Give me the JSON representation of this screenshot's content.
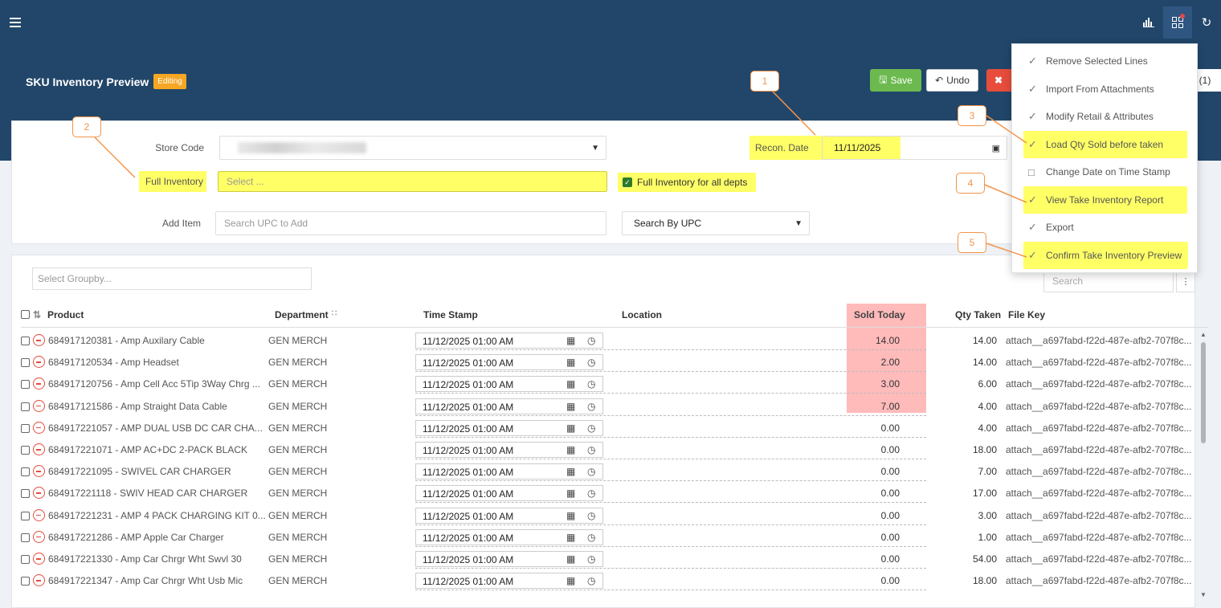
{
  "header": {
    "title": "SKU Inventory Preview",
    "status_badge": "Editing",
    "save_label": "Save",
    "undo_label": "Undo",
    "more_label": "(1)"
  },
  "top_icons": [
    "hamburger-menu-icon",
    "bar-chart-icon",
    "grid-apps-icon",
    "refresh-icon"
  ],
  "form": {
    "store_code_label": "Store Code",
    "recon_date_label": "Recon. Date",
    "recon_date_value": "11/11/2025",
    "full_inventory_label": "Full Inventory",
    "full_inventory_placeholder": "Select ...",
    "full_inventory_all_depts_label": "Full Inventory for all depts",
    "full_inventory_all_depts_checked": true,
    "add_item_label": "Add Item",
    "add_item_placeholder": "Search UPC to Add",
    "search_by_value": "Search By UPC"
  },
  "dropdown_menu": [
    {
      "label": "Remove Selected Lines",
      "icon": "check-icon",
      "highlighted": false
    },
    {
      "label": "Import From Attachments",
      "icon": "check-icon",
      "highlighted": false
    },
    {
      "label": "Modify Retail & Attributes",
      "icon": "check-icon",
      "highlighted": false
    },
    {
      "label": "Load Qty Sold before taken",
      "icon": "check-icon",
      "highlighted": true
    },
    {
      "label": "Change Date on Time Stamp",
      "icon": "calendar-icon",
      "highlighted": false
    },
    {
      "label": "View Take Inventory Report",
      "icon": "check-icon",
      "highlighted": true
    },
    {
      "label": "Export",
      "icon": "check-icon",
      "highlighted": false
    },
    {
      "label": "Confirm Take Inventory Preview",
      "icon": "check-icon",
      "highlighted": true
    }
  ],
  "callouts": [
    "1",
    "2",
    "3",
    "4",
    "5"
  ],
  "grid": {
    "groupby_placeholder": "Select Groupby...",
    "search_placeholder": "Search",
    "columns": {
      "product": "Product",
      "department": "Department",
      "time_stamp": "Time Stamp",
      "location": "Location",
      "sold_today": "Sold Today",
      "qty_taken": "Qty Taken",
      "file_key": "File Key"
    },
    "rows": [
      {
        "product": "684917120381 - Amp Auxilary Cable",
        "department": "GEN MERCH",
        "time_stamp": "11/12/2025 01:00 AM",
        "sold_today": "14.00",
        "qty_taken": "14.00",
        "file_key": "attach__a697fabd-f22d-487e-afb2-707f8c..."
      },
      {
        "product": "684917120534 - Amp Headset",
        "department": "GEN MERCH",
        "time_stamp": "11/12/2025 01:00 AM",
        "sold_today": "2.00",
        "qty_taken": "14.00",
        "file_key": "attach__a697fabd-f22d-487e-afb2-707f8c..."
      },
      {
        "product": "684917120756 - Amp Cell Acc 5Tip 3Way Chrg ...",
        "department": "GEN MERCH",
        "time_stamp": "11/12/2025 01:00 AM",
        "sold_today": "3.00",
        "qty_taken": "6.00",
        "file_key": "attach__a697fabd-f22d-487e-afb2-707f8c..."
      },
      {
        "product": "684917121586 - Amp Straight Data Cable",
        "department": "GEN MERCH",
        "time_stamp": "11/12/2025 01:00 AM",
        "sold_today": "7.00",
        "qty_taken": "4.00",
        "file_key": "attach__a697fabd-f22d-487e-afb2-707f8c..."
      },
      {
        "product": "684917221057 - AMP DUAL USB DC CAR CHA...",
        "department": "GEN MERCH",
        "time_stamp": "11/12/2025 01:00 AM",
        "sold_today": "0.00",
        "qty_taken": "4.00",
        "file_key": "attach__a697fabd-f22d-487e-afb2-707f8c..."
      },
      {
        "product": "684917221071 - AMP AC+DC 2-PACK BLACK",
        "department": "GEN MERCH",
        "time_stamp": "11/12/2025 01:00 AM",
        "sold_today": "0.00",
        "qty_taken": "18.00",
        "file_key": "attach__a697fabd-f22d-487e-afb2-707f8c..."
      },
      {
        "product": "684917221095 - SWIVEL CAR CHARGER",
        "department": "GEN MERCH",
        "time_stamp": "11/12/2025 01:00 AM",
        "sold_today": "0.00",
        "qty_taken": "7.00",
        "file_key": "attach__a697fabd-f22d-487e-afb2-707f8c..."
      },
      {
        "product": "684917221118 - SWIV HEAD CAR CHARGER",
        "department": "GEN MERCH",
        "time_stamp": "11/12/2025 01:00 AM",
        "sold_today": "0.00",
        "qty_taken": "17.00",
        "file_key": "attach__a697fabd-f22d-487e-afb2-707f8c..."
      },
      {
        "product": "684917221231 - AMP 4 PACK CHARGING KIT 0...",
        "department": "GEN MERCH",
        "time_stamp": "11/12/2025 01:00 AM",
        "sold_today": "0.00",
        "qty_taken": "3.00",
        "file_key": "attach__a697fabd-f22d-487e-afb2-707f8c..."
      },
      {
        "product": "684917221286 - AMP Apple Car Charger",
        "department": "GEN MERCH",
        "time_stamp": "11/12/2025 01:00 AM",
        "sold_today": "0.00",
        "qty_taken": "1.00",
        "file_key": "attach__a697fabd-f22d-487e-afb2-707f8c..."
      },
      {
        "product": "684917221330 - Amp Car Chrgr Wht Swvl 30",
        "department": "GEN MERCH",
        "time_stamp": "11/12/2025 01:00 AM",
        "sold_today": "0.00",
        "qty_taken": "54.00",
        "file_key": "attach__a697fabd-f22d-487e-afb2-707f8c..."
      },
      {
        "product": "684917221347 - Amp Car Chrgr Wht Usb Mic",
        "department": "GEN MERCH",
        "time_stamp": "11/12/2025 01:00 AM",
        "sold_today": "0.00",
        "qty_taken": "18.00",
        "file_key": "attach__a697fabd-f22d-487e-afb2-707f8c..."
      }
    ]
  },
  "colors": {
    "header_bg": "#21466a",
    "highlight": "#ffff66",
    "callout": "#f2944a",
    "sold_highlight": "#ffbaba",
    "save": "#6cba4f",
    "delete": "#e74c3c"
  }
}
